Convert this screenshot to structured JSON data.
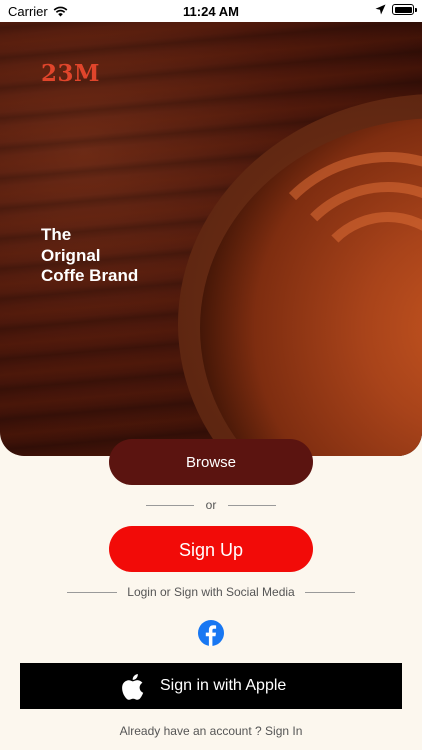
{
  "status_bar": {
    "carrier": "Carrier",
    "time": "11:24 AM"
  },
  "hero": {
    "logo": "23M",
    "tagline": "The\nOrignal\nCoffe Brand"
  },
  "actions": {
    "browse_label": "Browse",
    "or_label": "or",
    "signup_label": "Sign Up",
    "social_label": "Login or Sign with Social Media",
    "apple_label": "Sign in with Apple",
    "signin_prompt": "Already have an account ? Sign In"
  },
  "colors": {
    "browse_bg": "#5b1410",
    "signup_bg": "#f20b08",
    "logo": "#e0452b",
    "facebook": "#1877f2"
  },
  "icons": [
    "wifi-icon",
    "location-arrow-icon",
    "battery-icon",
    "facebook-icon",
    "apple-icon"
  ]
}
